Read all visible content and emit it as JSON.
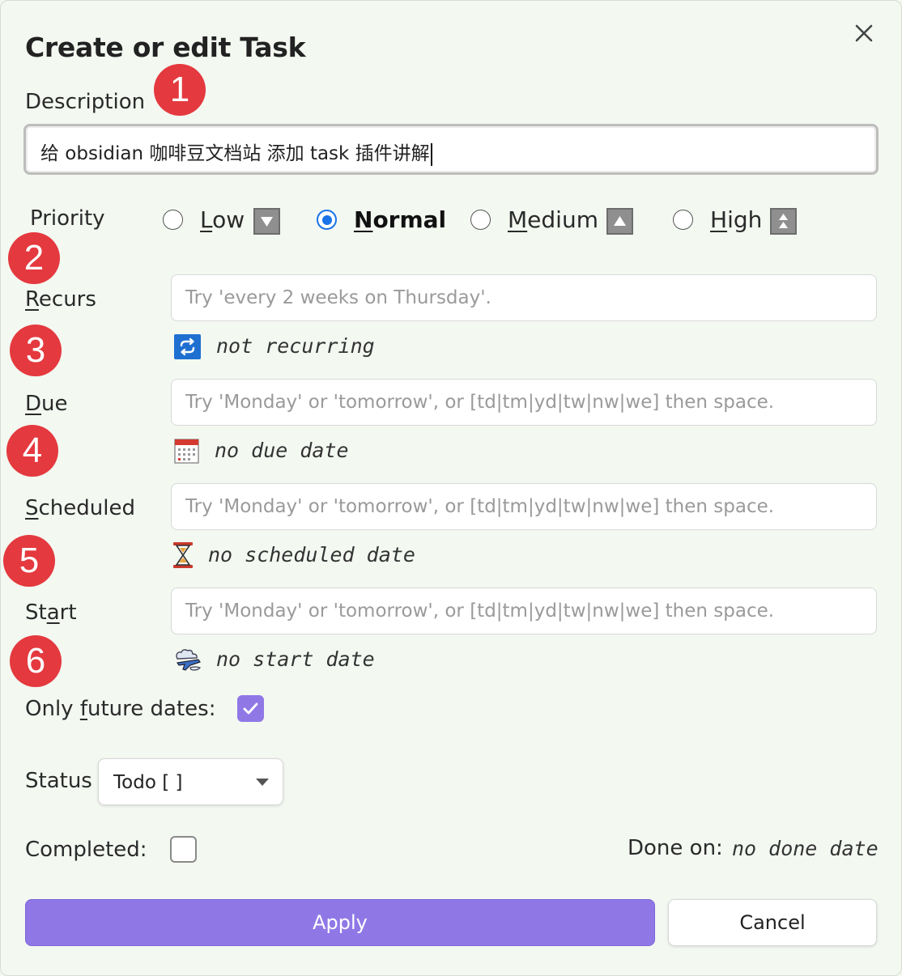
{
  "dialog": {
    "title": "Create or edit Task",
    "description_label": "Description",
    "description_value": "给 obsidian 咖啡豆文档站 添加 task 插件讲解"
  },
  "priority": {
    "label": "Priority",
    "selected": "Normal",
    "options": [
      {
        "label": "Low",
        "icon": "down-arrow-icon"
      },
      {
        "label": "Normal",
        "icon": ""
      },
      {
        "label": "Medium",
        "icon": "up-arrow-icon"
      },
      {
        "label": "High",
        "icon": "double-up-arrow-icon"
      }
    ]
  },
  "recurs": {
    "label": "Recurs",
    "placeholder": "Try 'every 2 weeks on Thursday'.",
    "hint": "not recurring",
    "icon": "repeat-icon"
  },
  "due": {
    "label": "Due",
    "placeholder": "Try 'Monday' or 'tomorrow', or [td|tm|yd|tw|nw|we] then space.",
    "hint": "no due date",
    "icon": "calendar-icon"
  },
  "scheduled": {
    "label": "Scheduled",
    "placeholder": "Try 'Monday' or 'tomorrow', or [td|tm|yd|tw|nw|we] then space.",
    "hint": "no scheduled date",
    "icon": "hourglass-icon"
  },
  "start": {
    "label": "Start",
    "placeholder": "Try 'Monday' or 'tomorrow', or [td|tm|yd|tw|nw|we] then space.",
    "hint": "no start date",
    "icon": "airplane-icon"
  },
  "future": {
    "label": "Only future dates:",
    "checked": true
  },
  "status": {
    "label": "Status",
    "value": "Todo [ ]"
  },
  "completed": {
    "label": "Completed:",
    "checked": false
  },
  "done": {
    "label": "Done on:",
    "value": "no done date"
  },
  "buttons": {
    "apply": "Apply",
    "cancel": "Cancel"
  },
  "badges": [
    "1",
    "2",
    "3",
    "4",
    "5",
    "6"
  ],
  "colors": {
    "accent": "#8f78e6",
    "radio": "#1a73e8",
    "badge": "#e4393e",
    "background": "#f3f8f1"
  }
}
